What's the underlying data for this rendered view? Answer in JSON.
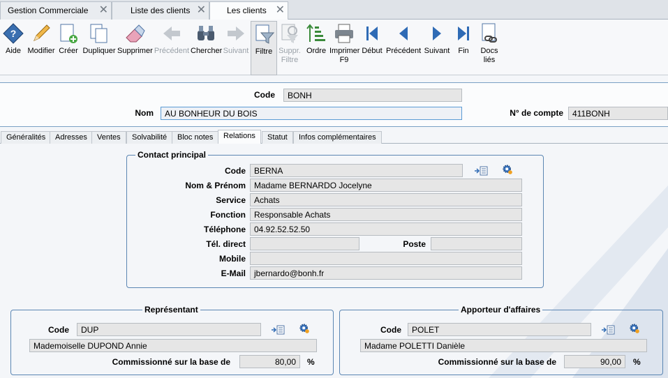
{
  "window_tabs": [
    {
      "label": "Gestion Commerciale"
    },
    {
      "label": "Liste des clients"
    },
    {
      "label": "Les clients"
    }
  ],
  "toolbar": [
    {
      "label": "Aide",
      "icon": "help-icon"
    },
    {
      "label": "Modifier",
      "icon": "pencil-icon"
    },
    {
      "label": "Créer",
      "icon": "new-document-icon"
    },
    {
      "label": "Dupliquer",
      "icon": "duplicate-icon"
    },
    {
      "label": "Supprimer",
      "icon": "eraser-icon"
    },
    {
      "label": "Précédent",
      "icon": "arrow-left-icon",
      "disabled": true
    },
    {
      "label": "Chercher",
      "icon": "binoculars-icon"
    },
    {
      "label": "Suivant",
      "icon": "arrow-right-icon",
      "disabled": true
    },
    {
      "label": "Filtre",
      "icon": "filter-icon",
      "selected": true
    },
    {
      "label": "Suppr.",
      "label2": "Filtre",
      "icon": "remove-filter-icon",
      "disabled": true
    },
    {
      "label": "Ordre",
      "icon": "sort-order-icon"
    },
    {
      "label": "Imprimer",
      "label2": "F9",
      "icon": "printer-icon"
    },
    {
      "label": "Début",
      "icon": "first-icon"
    },
    {
      "label": "Précédent",
      "icon": "previous-icon"
    },
    {
      "label": "Suivant",
      "icon": "next-icon"
    },
    {
      "label": "Fin",
      "icon": "last-icon"
    },
    {
      "label": "Docs",
      "label2": "liés",
      "icon": "linked-docs-icon"
    }
  ],
  "header": {
    "code_label": "Code",
    "code_value": "BONH",
    "nom_label": "Nom",
    "nom_value": "AU BONHEUR DU BOIS",
    "compte_label": "N° de compte",
    "compte_value": "411BONH"
  },
  "page_tabs": [
    {
      "label": "Généralités"
    },
    {
      "label": "Adresses"
    },
    {
      "label": "Ventes"
    },
    {
      "label": "Solvabilité"
    },
    {
      "label": "Bloc notes"
    },
    {
      "label": "Relations",
      "active": true
    },
    {
      "label": "Statut"
    },
    {
      "label": "Infos complémentaires"
    }
  ],
  "contact": {
    "title": "Contact principal",
    "code_label": "Code",
    "code": "BERNA",
    "nom_label": "Nom & Prénom",
    "nom": "Madame BERNARDO Jocelyne",
    "service_label": "Service",
    "service": "Achats",
    "fonction_label": "Fonction",
    "fonction": "Responsable Achats",
    "tel_label": "Téléphone",
    "tel": "04.92.52.52.50",
    "teldirect_label": "Tél. direct",
    "teldirect": "",
    "poste_label": "Poste",
    "poste": "",
    "mobile_label": "Mobile",
    "mobile": "",
    "email_label": "E-Mail",
    "email": "jbernardo@bonh.fr"
  },
  "representant": {
    "title": "Représentant",
    "code_label": "Code",
    "code": "DUP",
    "name": "Mademoiselle DUPOND Annie",
    "comm_label": "Commissionné sur la base de",
    "comm": "80,00",
    "pct": "%"
  },
  "apporteur": {
    "title": "Apporteur d'affaires",
    "code_label": "Code",
    "code": "POLET",
    "name": "Madame POLETTI Danièle",
    "comm_label": "Commissionné sur la base de",
    "comm": "90,00",
    "pct": "%"
  }
}
